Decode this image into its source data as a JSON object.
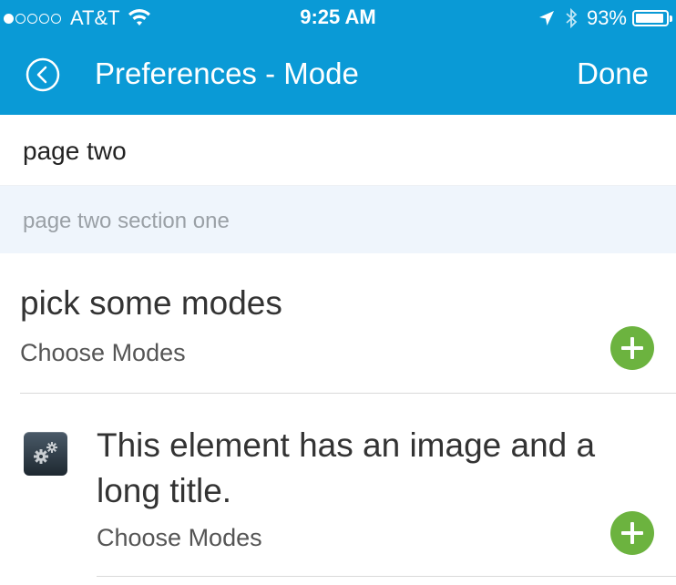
{
  "status_bar": {
    "carrier": "AT&T",
    "signal_dots_filled": 1,
    "signal_dots_total": 5,
    "time": "9:25 AM",
    "battery": "93%",
    "icons": [
      "wifi-icon",
      "location-arrow-icon",
      "bluetooth-icon",
      "battery-icon"
    ]
  },
  "nav": {
    "back_icon": "chevron-left-circle-icon",
    "title": "Preferences - Mode",
    "done_label": "Done"
  },
  "page": {
    "name": "page two",
    "section_header": "page two section one"
  },
  "rows": [
    {
      "title": "pick some modes",
      "subtitle": "Choose Modes",
      "action_icon": "add-icon"
    },
    {
      "image_icon": "gears-icon",
      "title": "This element has an image and a long title.",
      "subtitle": "Choose Modes",
      "action_icon": "add-icon"
    }
  ],
  "colors": {
    "header_bg": "#0a9ad6",
    "section_bg": "#eff5fc",
    "add_button": "#6cb33f"
  }
}
